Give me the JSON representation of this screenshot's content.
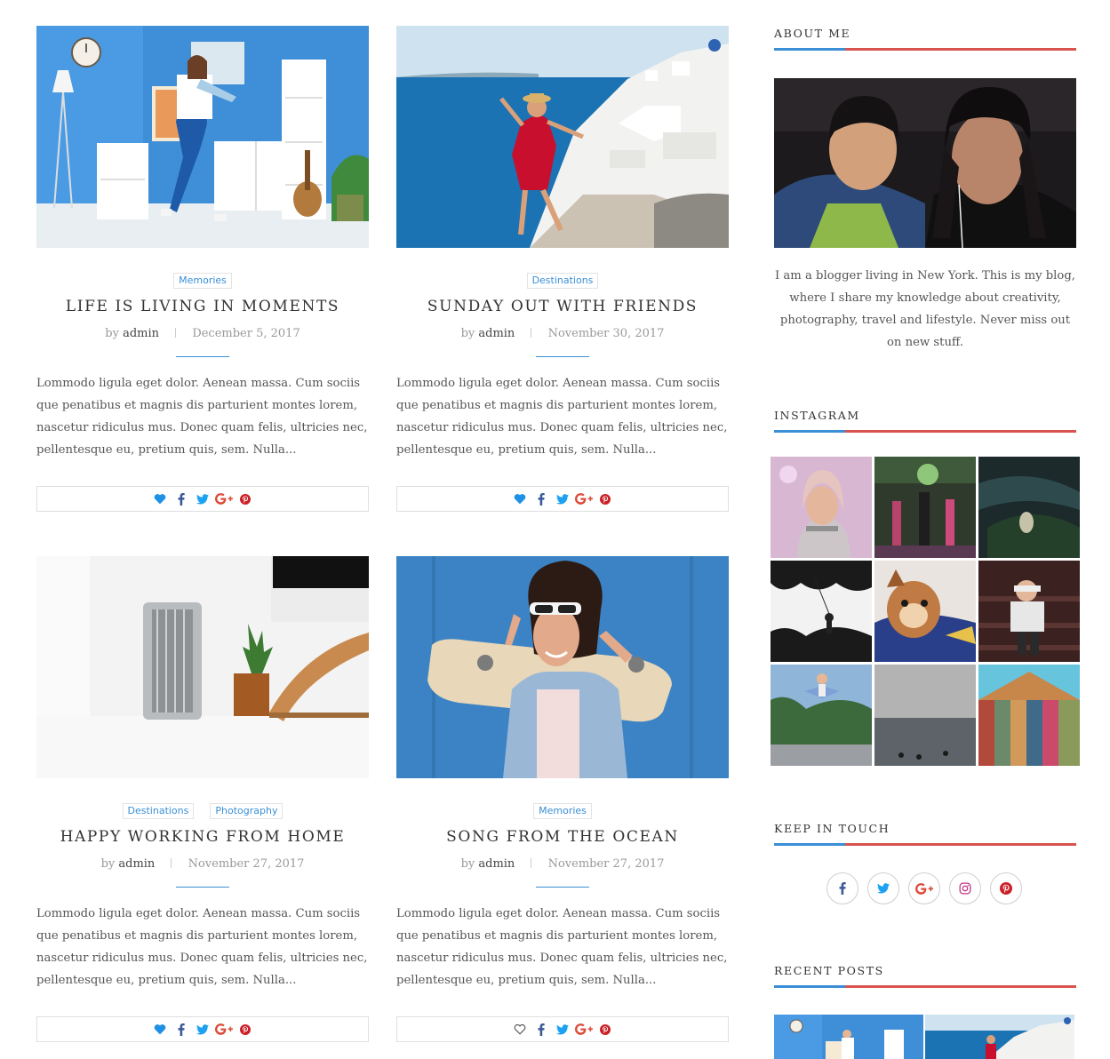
{
  "posts": [
    {
      "categories": [
        "Memories"
      ],
      "title": "LIFE IS LIVING IN MOMENTS",
      "by": "by",
      "author": "admin",
      "date": "December 5, 2017",
      "excerpt": "Lommodo ligula eget dolor. Aenean massa. Cum sociis que penatibus et magnis dis parturient montes lorem, nascetur ridiculus mus. Donec quam felis, ultricies nec, pellentesque eu, pretium quis, sem. Nulla...",
      "liked": true
    },
    {
      "categories": [
        "Destinations"
      ],
      "title": "SUNDAY OUT WITH FRIENDS",
      "by": "by",
      "author": "admin",
      "date": "November 30, 2017",
      "excerpt": "Lommodo ligula eget dolor. Aenean massa. Cum sociis que penatibus et magnis dis parturient montes lorem, nascetur ridiculus mus. Donec quam felis, ultricies nec, pellentesque eu, pretium quis, sem. Nulla...",
      "liked": true
    },
    {
      "categories": [
        "Destinations",
        "Photography"
      ],
      "title": "HAPPY WORKING FROM HOME",
      "by": "by",
      "author": "admin",
      "date": "November 27, 2017",
      "excerpt": "Lommodo ligula eget dolor. Aenean massa. Cum sociis que penatibus et magnis dis parturient montes lorem, nascetur ridiculus mus. Donec quam felis, ultricies nec, pellentesque eu, pretium quis, sem. Nulla...",
      "liked": true
    },
    {
      "categories": [
        "Memories"
      ],
      "title": "SONG FROM THE OCEAN",
      "by": "by",
      "author": "admin",
      "date": "November 27, 2017",
      "excerpt": "Lommodo ligula eget dolor. Aenean massa. Cum sociis que penatibus et magnis dis parturient montes lorem, nascetur ridiculus mus. Donec quam felis, ultricies nec, pellentesque eu, pretium quis, sem. Nulla...",
      "liked": false
    }
  ],
  "share_icons": [
    "heart-icon",
    "facebook-icon",
    "twitter-icon",
    "google-plus-icon",
    "pinterest-icon"
  ],
  "sidebar": {
    "about": {
      "title": "ABOUT ME",
      "text": "I am a blogger living in New York. This is my blog, where I share my knowledge about creativity, photography, travel and lifestyle. Never miss out on new stuff."
    },
    "instagram": {
      "title": "INSTAGRAM"
    },
    "keep_in_touch": {
      "title": "KEEP IN TOUCH",
      "icons": [
        "facebook-icon",
        "twitter-icon",
        "google-plus-icon",
        "instagram-icon",
        "pinterest-icon"
      ]
    },
    "recent_posts": {
      "title": "RECENT POSTS"
    }
  },
  "colors": {
    "accent_blue": "#3a8fd6",
    "accent_red": "#d9534f",
    "facebook": "#3b5998",
    "twitter": "#1da1f2",
    "google_plus": "#dd4b39",
    "pinterest": "#cb2027",
    "instagram": "#c13584"
  }
}
